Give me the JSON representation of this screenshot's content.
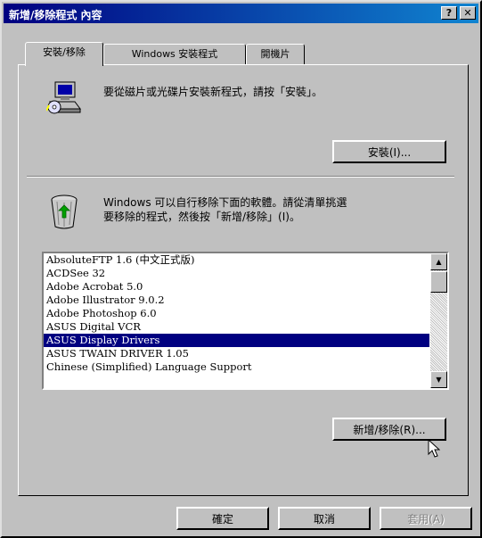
{
  "window": {
    "title": "新增/移除程式 內容",
    "help_btn": "?",
    "close_btn": "✕"
  },
  "tabs": [
    {
      "label": "安裝/移除"
    },
    {
      "label": "Windows 安裝程式"
    },
    {
      "label": "開機片"
    }
  ],
  "install_section": {
    "description": "要從磁片或光碟片安裝新程式，請按「安裝」。",
    "install_button": "安裝(I)..."
  },
  "remove_section": {
    "description_line1": "Windows 可以自行移除下面的軟體。請從清單挑選",
    "description_line2": "要移除的程式，然後按「新增/移除」(I)。",
    "programs": [
      "AbsoluteFTP 1.6 (中文正式版)",
      "ACDSee 32",
      "Adobe Acrobat 5.0",
      "Adobe Illustrator 9.0.2",
      "Adobe Photoshop 6.0",
      "ASUS Digital VCR",
      "ASUS Display Drivers",
      "ASUS TWAIN DRIVER 1.05",
      "Chinese (Simplified) Language Support"
    ],
    "selected_index": 6,
    "add_remove_button": "新增/移除(R)..."
  },
  "footer": {
    "ok": "確定",
    "cancel": "取消",
    "apply": "套用(A)"
  },
  "colors": {
    "title_start": "#000080",
    "title_end": "#1084d0",
    "selection": "#000080"
  }
}
